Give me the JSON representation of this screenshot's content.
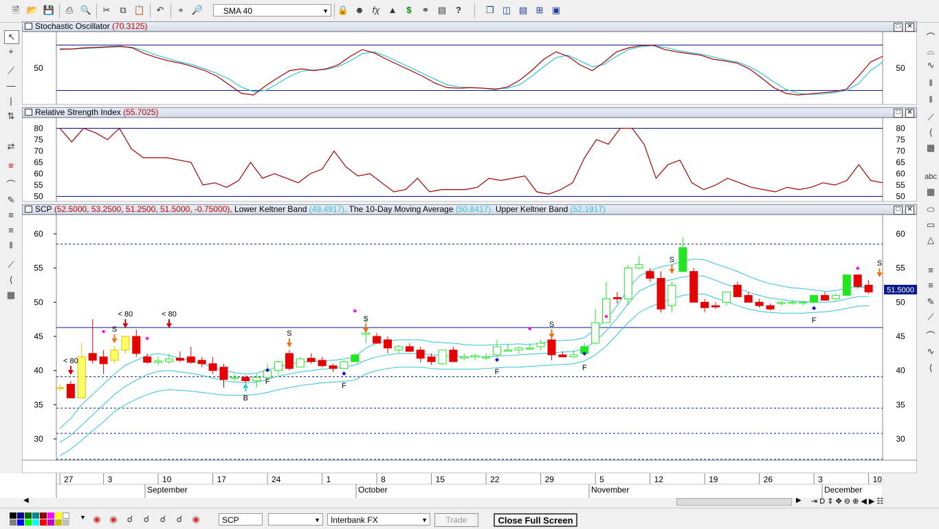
{
  "toolbar": {
    "indicator_select": "SMA 40",
    "icons": [
      "new-file-icon",
      "open-folder-icon",
      "save-icon",
      "print-icon",
      "print-preview-icon",
      "cut-icon",
      "copy-icon",
      "paste-icon",
      "undo-icon",
      "crosshair-icon",
      "zoom-icon",
      "lock-icon",
      "wizard-icon",
      "formula-icon",
      "chart-icon",
      "dollar-icon",
      "binoculars-icon",
      "properties-icon",
      "help-icon",
      "tile-windows-icon",
      "columns-icon",
      "rows-icon",
      "grid-icon",
      "layout-icon"
    ]
  },
  "stoch": {
    "title": "Stochastic Oscillator",
    "value": "(70.3125)",
    "y_tick": "50",
    "colors": {
      "main": "#a40000",
      "signal": "#33c3d9",
      "bounds": "#0b1b8c"
    }
  },
  "rsi": {
    "title": "Relative Strength Index",
    "value": "(55.7025)",
    "y_ticks": [
      "80",
      "75",
      "70",
      "65",
      "60",
      "55",
      "50"
    ],
    "color": "#a40000"
  },
  "price": {
    "symbol": "SCP",
    "ohlc": "(52.5000, 53.2500, 51.2500, 51.5000, -0.75000),",
    "lower_label": "Lower Keltner Band",
    "lower_value": "(49.4917),",
    "ma_label": "The 10-Day Moving Average",
    "ma_value": "(50.8417),",
    "upper_label": "Upper Keltner Band",
    "upper_value": "(52.1917)",
    "last_price": "51.5000",
    "y_ticks": [
      "60",
      "55",
      "50",
      "45",
      "40",
      "35",
      "30"
    ],
    "annotations": {
      "lt80": "< 80",
      "s": "S",
      "b": "B",
      "f": "F"
    },
    "colors": {
      "up": "#22e622",
      "down": "#e60000",
      "band": "#33c3d9",
      "signal_dot": "#ff00ff",
      "buy_arrow": "#22d0d0",
      "sell_arrow": "#f07010",
      "f_marker": "#1010c0"
    }
  },
  "x_axis": {
    "days": [
      "27",
      "3",
      "10",
      "17",
      "24",
      "1",
      "8",
      "15",
      "22",
      "29",
      "5",
      "12",
      "19",
      "26",
      "3",
      "10"
    ],
    "months": [
      "September",
      "October",
      "November",
      "December"
    ]
  },
  "bottom": {
    "symbol": "SCP",
    "broker": "Interbank FX",
    "trade": "Trade",
    "close_full_screen": "Close Full Screen"
  },
  "chart_data": {
    "type": "candlestick",
    "title": "SCP",
    "ylim": [
      27,
      63
    ],
    "candles": [
      {
        "o": 37.5,
        "h": 38,
        "l": 37,
        "c": 37.5
      },
      {
        "o": 38,
        "h": 38.5,
        "l": 36,
        "c": 36
      },
      {
        "o": 36,
        "h": 44,
        "l": 36,
        "c": 42
      },
      {
        "o": 42.5,
        "h": 47.5,
        "l": 41,
        "c": 41.5
      },
      {
        "o": 42,
        "h": 43,
        "l": 39.5,
        "c": 41
      },
      {
        "o": 41.5,
        "h": 43.5,
        "l": 41,
        "c": 43
      },
      {
        "o": 43,
        "h": 45,
        "l": 42.5,
        "c": 45
      },
      {
        "o": 45,
        "h": 46,
        "l": 42,
        "c": 42.5
      },
      {
        "o": 42,
        "h": 42.5,
        "l": 41,
        "c": 41.2
      },
      {
        "o": 41.2,
        "h": 42,
        "l": 40.8,
        "c": 41.4
      },
      {
        "o": 41.3,
        "h": 42.5,
        "l": 41,
        "c": 41.7
      },
      {
        "o": 41.8,
        "h": 42.8,
        "l": 41.2,
        "c": 41.5
      },
      {
        "o": 42,
        "h": 43.5,
        "l": 41,
        "c": 41.2
      },
      {
        "o": 41.5,
        "h": 42,
        "l": 40.5,
        "c": 41
      },
      {
        "o": 41,
        "h": 42,
        "l": 39.5,
        "c": 40
      },
      {
        "o": 40.5,
        "h": 41,
        "l": 37.5,
        "c": 38.7
      },
      {
        "o": 39,
        "h": 39.5,
        "l": 38.5,
        "c": 39
      },
      {
        "o": 39,
        "h": 39.3,
        "l": 38.2,
        "c": 38.5
      },
      {
        "o": 38.5,
        "h": 39.5,
        "l": 37.5,
        "c": 39
      },
      {
        "o": 39,
        "h": 41,
        "l": 38.8,
        "c": 40
      },
      {
        "o": 40,
        "h": 41.5,
        "l": 39.5,
        "c": 41.3
      },
      {
        "o": 42.5,
        "h": 43,
        "l": 40,
        "c": 40.3
      },
      {
        "o": 40.5,
        "h": 42,
        "l": 40.5,
        "c": 41.7
      },
      {
        "o": 41.8,
        "h": 42.5,
        "l": 41,
        "c": 41.3
      },
      {
        "o": 41.5,
        "h": 42,
        "l": 40.5,
        "c": 40.7
      },
      {
        "o": 40.7,
        "h": 41,
        "l": 39.8,
        "c": 40.3
      },
      {
        "o": 40.3,
        "h": 41.5,
        "l": 40.3,
        "c": 41.3
      },
      {
        "o": 41.3,
        "h": 42.5,
        "l": 41.3,
        "c": 42.3
      },
      {
        "o": 45.3,
        "h": 48,
        "l": 44,
        "c": 45.5
      },
      {
        "o": 45,
        "h": 45.5,
        "l": 44,
        "c": 44
      },
      {
        "o": 44.5,
        "h": 45,
        "l": 42.5,
        "c": 43.3
      },
      {
        "o": 43,
        "h": 43.8,
        "l": 42.5,
        "c": 43.5
      },
      {
        "o": 43.5,
        "h": 44,
        "l": 42.8,
        "c": 42.8
      },
      {
        "o": 43,
        "h": 43.5,
        "l": 41.2,
        "c": 41.8
      },
      {
        "o": 42,
        "h": 42.5,
        "l": 40.8,
        "c": 41.3
      },
      {
        "o": 41,
        "h": 43,
        "l": 40.8,
        "c": 43
      },
      {
        "o": 43,
        "h": 43.5,
        "l": 41.3,
        "c": 41.3
      },
      {
        "o": 41.8,
        "h": 42.5,
        "l": 41.5,
        "c": 42
      },
      {
        "o": 42,
        "h": 42.5,
        "l": 41.5,
        "c": 42.2
      },
      {
        "o": 42,
        "h": 42.5,
        "l": 41.5,
        "c": 42
      },
      {
        "o": 42.3,
        "h": 44.5,
        "l": 42,
        "c": 43.5
      },
      {
        "o": 43,
        "h": 44,
        "l": 42.8,
        "c": 43
      },
      {
        "o": 43,
        "h": 43.5,
        "l": 42.5,
        "c": 43.3
      },
      {
        "o": 43.3,
        "h": 44,
        "l": 43,
        "c": 43.3
      },
      {
        "o": 43.5,
        "h": 44.5,
        "l": 43,
        "c": 44
      },
      {
        "o": 44.5,
        "h": 45,
        "l": 41.5,
        "c": 42.3
      },
      {
        "o": 42.3,
        "h": 42.8,
        "l": 42,
        "c": 42
      },
      {
        "o": 42,
        "h": 43,
        "l": 41.8,
        "c": 42.3
      },
      {
        "o": 42.5,
        "h": 44,
        "l": 42.2,
        "c": 43.5
      },
      {
        "o": 44,
        "h": 49,
        "l": 43.8,
        "c": 47
      },
      {
        "o": 47,
        "h": 53,
        "l": 47,
        "c": 50.5
      },
      {
        "o": 50.7,
        "h": 51.5,
        "l": 49.8,
        "c": 50.5
      },
      {
        "o": 50.5,
        "h": 55.5,
        "l": 49.5,
        "c": 55
      },
      {
        "o": 55,
        "h": 56.8,
        "l": 54.8,
        "c": 55.5
      },
      {
        "o": 54.5,
        "h": 55,
        "l": 53,
        "c": 53.5
      },
      {
        "o": 53.5,
        "h": 54.5,
        "l": 48.5,
        "c": 49
      },
      {
        "o": 49.5,
        "h": 53,
        "l": 48.5,
        "c": 52.5
      },
      {
        "o": 54.5,
        "h": 59.5,
        "l": 54.5,
        "c": 58
      },
      {
        "o": 54.5,
        "h": 55,
        "l": 50,
        "c": 50
      },
      {
        "o": 50,
        "h": 50.5,
        "l": 48.5,
        "c": 49.2
      },
      {
        "o": 49.5,
        "h": 50,
        "l": 49,
        "c": 49.3
      },
      {
        "o": 50,
        "h": 51.5,
        "l": 49.5,
        "c": 51.5
      },
      {
        "o": 52.5,
        "h": 53,
        "l": 50.8,
        "c": 50.8
      },
      {
        "o": 51,
        "h": 51.5,
        "l": 50,
        "c": 50
      },
      {
        "o": 50,
        "h": 50.5,
        "l": 49.2,
        "c": 49.5
      },
      {
        "o": 49.5,
        "h": 49.8,
        "l": 48.8,
        "c": 49
      },
      {
        "o": 49.8,
        "h": 50.2,
        "l": 49.5,
        "c": 50
      },
      {
        "o": 49.9,
        "h": 50.3,
        "l": 49.6,
        "c": 50
      },
      {
        "o": 49.9,
        "h": 50.2,
        "l": 49.5,
        "c": 50
      },
      {
        "o": 50,
        "h": 51,
        "l": 49.8,
        "c": 51
      },
      {
        "o": 51,
        "h": 51.5,
        "l": 50.2,
        "c": 50.3
      },
      {
        "o": 50.5,
        "h": 51.3,
        "l": 50.3,
        "c": 51
      },
      {
        "o": 51,
        "h": 54,
        "l": 51,
        "c": 54
      },
      {
        "o": 54,
        "h": 54,
        "l": 52,
        "c": 52.3
      },
      {
        "o": 52.5,
        "h": 53.25,
        "l": 51.25,
        "c": 51.5
      }
    ],
    "upper_band": [
      31.5,
      33,
      35,
      36.5,
      38,
      39.5,
      40.8,
      41.5,
      42.2,
      42.5,
      42.2,
      41.8,
      41.5,
      41,
      40.5,
      40,
      39.7,
      39.5,
      39.6,
      40.1,
      40.6,
      40.9,
      41.2,
      41.3,
      41.4,
      41.5,
      41.7,
      42,
      43.3,
      44,
      44.3,
      44.5,
      44.5,
      44.5,
      44.2,
      44.1,
      44,
      43.8,
      43.7,
      43.7,
      43.8,
      43.8,
      43.9,
      43.8,
      44,
      44.3,
      44.4,
      44.5,
      44.8,
      46,
      47.5,
      49.5,
      52,
      53.8,
      54.6,
      55.2,
      55.5,
      56,
      56.3,
      56.2,
      55.6,
      55.1,
      54.5,
      53.8,
      53.2,
      52.7,
      52.4,
      52.1,
      52,
      51.8,
      51.6,
      51.7,
      52.1,
      52.2,
      52.19
    ],
    "middle_ma": [
      29.5,
      30.5,
      32,
      33.5,
      35,
      36.5,
      37.7,
      38.6,
      39.4,
      39.9,
      40,
      39.8,
      39.6,
      39.3,
      38.9,
      38.5,
      38.3,
      38.2,
      38.3,
      38.7,
      39.2,
      39.5,
      39.8,
      40,
      40.2,
      40.3,
      40.5,
      40.8,
      41.5,
      42,
      42.3,
      42.5,
      42.5,
      42.5,
      42.3,
      42.2,
      42.1,
      42,
      42,
      42,
      42.1,
      42.2,
      42.3,
      42.4,
      42.5,
      42.6,
      42.7,
      42.8,
      43.2,
      44.3,
      45.8,
      47.7,
      49.8,
      51.6,
      52.4,
      53,
      53.3,
      53.7,
      53.9,
      53.8,
      53.2,
      52.6,
      52.1,
      51.5,
      51,
      50.6,
      50.4,
      50.2,
      50.1,
      50,
      50,
      50.1,
      50.5,
      50.8,
      50.84
    ],
    "lower_band": [
      27.5,
      28.5,
      29.8,
      31.2,
      32.5,
      34,
      35,
      35.8,
      36.5,
      37,
      37.2,
      37.1,
      37,
      36.8,
      36.6,
      36.4,
      36.4,
      36.4,
      36.5,
      36.8,
      37.2,
      37.5,
      37.8,
      38,
      38.2,
      38.3,
      38.4,
      38.6,
      39.5,
      40,
      40.3,
      40.5,
      40.5,
      40.5,
      40.3,
      40.2,
      40.2,
      40.2,
      40.2,
      40.3,
      40.4,
      40.5,
      40.5,
      40.6,
      40.7,
      40.8,
      40.9,
      41,
      41.4,
      42.3,
      43.6,
      45.3,
      47,
      48.5,
      49.3,
      50,
      50.5,
      51,
      51.2,
      51.2,
      50.6,
      50.1,
      49.5,
      49,
      48.7,
      48.5,
      48.4,
      48.4,
      48.4,
      48.5,
      48.6,
      48.8,
      49.1,
      49.4,
      49.49
    ],
    "horizontal_lines": [
      58.5,
      46.3,
      39.1,
      34.5,
      30.8,
      27
    ]
  }
}
